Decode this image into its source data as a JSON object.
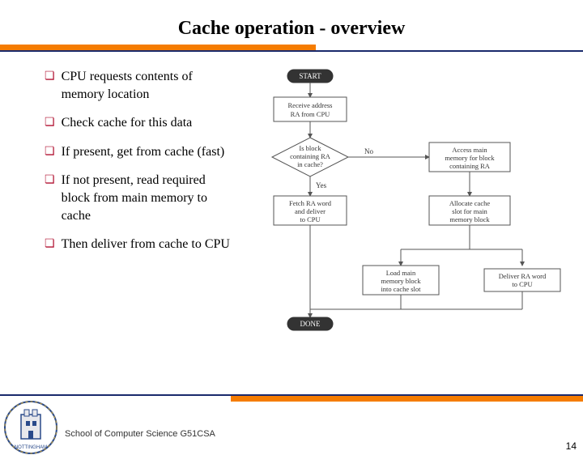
{
  "title": "Cache operation - overview",
  "bullets": [
    "CPU requests contents of memory location",
    "Check cache for this data",
    "If present, get from cache (fast)",
    "If not present, read required block from main memory to cache",
    "Then deliver from cache to CPU"
  ],
  "flowchart": {
    "start": "START",
    "receive": "Receive address RA from CPU",
    "decision": "Is block containing RA in cache?",
    "no": "No",
    "yes": "Yes",
    "fetch": "Fetch RA word and deliver to CPU",
    "access": "Access main memory for block containing RA",
    "allocate": "Allocate cache slot for main memory block",
    "load": "Load main memory block into cache slot",
    "deliver": "Deliver RA word to CPU",
    "done": "DONE"
  },
  "footer": "School of Computer Science G51CSA",
  "page": "14"
}
